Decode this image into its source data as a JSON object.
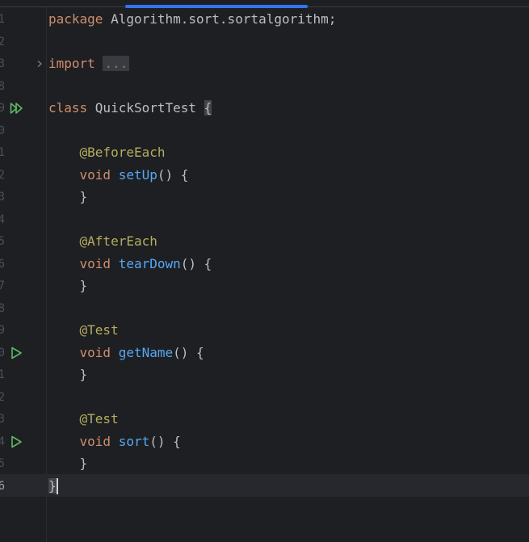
{
  "editor": {
    "lines": [
      {
        "num": "1",
        "tokens": [
          {
            "t": "package ",
            "c": "kw"
          },
          {
            "t": "Algorithm.sort.sortalgorithm;",
            "c": "plain"
          }
        ]
      },
      {
        "num": "2",
        "tokens": []
      },
      {
        "num": "3",
        "tokens": [
          {
            "t": "import ",
            "c": "kw"
          },
          {
            "t": "...",
            "c": "fold-chip"
          }
        ],
        "fold": true
      },
      {
        "num": "8",
        "tokens": []
      },
      {
        "num": "9",
        "tokens": [
          {
            "t": "class ",
            "c": "kw"
          },
          {
            "t": "QuickSortTest ",
            "c": "plain"
          },
          {
            "t": "{",
            "c": "brace-hl"
          }
        ],
        "run": "double"
      },
      {
        "num": "0",
        "tokens": []
      },
      {
        "num": "1",
        "tokens": [
          {
            "t": "    ",
            "c": "plain"
          },
          {
            "t": "@BeforeEach",
            "c": "ann"
          }
        ]
      },
      {
        "num": "2",
        "tokens": [
          {
            "t": "    ",
            "c": "plain"
          },
          {
            "t": "void ",
            "c": "kw"
          },
          {
            "t": "setUp",
            "c": "fn"
          },
          {
            "t": "() {",
            "c": "plain"
          }
        ]
      },
      {
        "num": "3",
        "tokens": [
          {
            "t": "    }",
            "c": "plain"
          }
        ]
      },
      {
        "num": "4",
        "tokens": []
      },
      {
        "num": "5",
        "tokens": [
          {
            "t": "    ",
            "c": "plain"
          },
          {
            "t": "@AfterEach",
            "c": "ann"
          }
        ]
      },
      {
        "num": "6",
        "tokens": [
          {
            "t": "    ",
            "c": "plain"
          },
          {
            "t": "void ",
            "c": "kw"
          },
          {
            "t": "tearDown",
            "c": "fn"
          },
          {
            "t": "() {",
            "c": "plain"
          }
        ]
      },
      {
        "num": "7",
        "tokens": [
          {
            "t": "    }",
            "c": "plain"
          }
        ]
      },
      {
        "num": "8",
        "tokens": []
      },
      {
        "num": "9",
        "tokens": [
          {
            "t": "    ",
            "c": "plain"
          },
          {
            "t": "@Test",
            "c": "ann"
          }
        ]
      },
      {
        "num": "0",
        "tokens": [
          {
            "t": "    ",
            "c": "plain"
          },
          {
            "t": "void ",
            "c": "kw"
          },
          {
            "t": "getName",
            "c": "fn"
          },
          {
            "t": "() {",
            "c": "plain"
          }
        ],
        "run": "single"
      },
      {
        "num": "1",
        "tokens": [
          {
            "t": "    }",
            "c": "plain"
          }
        ]
      },
      {
        "num": "2",
        "tokens": []
      },
      {
        "num": "3",
        "tokens": [
          {
            "t": "    ",
            "c": "plain"
          },
          {
            "t": "@Test",
            "c": "ann"
          }
        ]
      },
      {
        "num": "4",
        "tokens": [
          {
            "t": "    ",
            "c": "plain"
          },
          {
            "t": "void ",
            "c": "kw"
          },
          {
            "t": "sort",
            "c": "fn"
          },
          {
            "t": "() {",
            "c": "plain"
          }
        ],
        "run": "single"
      },
      {
        "num": "5",
        "tokens": [
          {
            "t": "    }",
            "c": "plain"
          }
        ]
      },
      {
        "num": "6",
        "tokens": [
          {
            "t": "}",
            "c": "brace-hl"
          }
        ],
        "current": true,
        "caret": true
      }
    ]
  },
  "icons": {
    "run_single": "run-test-icon",
    "run_double": "run-all-tests-icon",
    "fold": "fold-chevron-icon"
  },
  "colors": {
    "background": "#1e1f22",
    "keyword": "#cf8e6d",
    "annotation": "#b3ae60",
    "function": "#56a8f5",
    "text": "#bcbec4",
    "run_green": "#5fb865",
    "accent": "#3574f0"
  }
}
